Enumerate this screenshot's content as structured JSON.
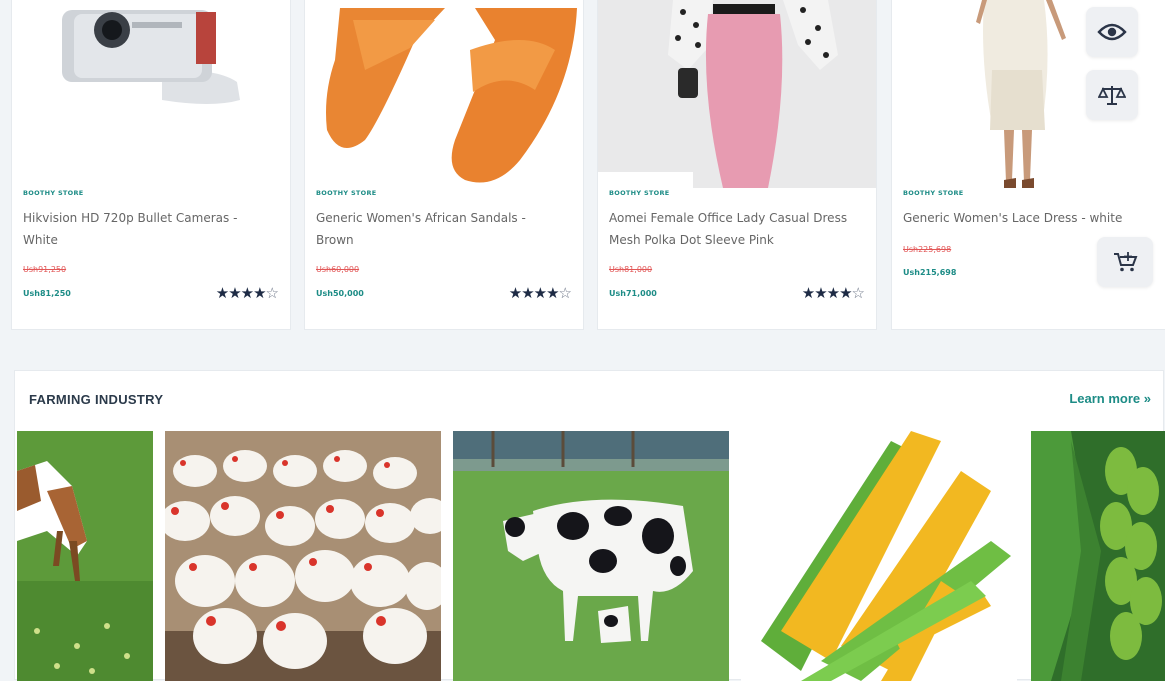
{
  "products": [
    {
      "store": "BOOTHY STORE",
      "name": "Hikvision HD 720p Bullet Cameras - White",
      "old_price": "Ush91,250",
      "new_price": "Ush81,250",
      "stars_filled": "★★★★",
      "stars_empty": "☆",
      "rating": 4
    },
    {
      "store": "BOOTHY STORE",
      "name": "Generic Women's African Sandals - Brown",
      "old_price": "Ush60,000",
      "new_price": "Ush50,000",
      "stars_filled": "★★★★",
      "stars_empty": "☆",
      "rating": 4
    },
    {
      "store": "BOOTHY STORE",
      "name": "Aomei Female Office Lady Casual Dress Mesh Polka Dot Sleeve Pink",
      "old_price": "Ush81,000",
      "new_price": "Ush71,000",
      "stars_filled": "★★★★",
      "stars_empty": "☆",
      "rating": 4
    },
    {
      "store": "BOOTHY STORE",
      "name": "Generic Women's Lace Dress - white",
      "old_price": "Ush225,698",
      "new_price": "Ush215,698"
    }
  ],
  "actions": {
    "quick_view": "eye-icon",
    "compare": "scale-icon",
    "add_to_cart": "cart-icon"
  },
  "farming": {
    "title": "FARMING INDUSTRY",
    "learn_more": "Learn more »",
    "images": [
      "goat",
      "chickens",
      "cow",
      "corn",
      "bananas"
    ]
  },
  "colors": {
    "accent": "#1d8c86",
    "old_price": "#e25656",
    "star": "#1e2b45",
    "background": "#f1f4f7"
  }
}
